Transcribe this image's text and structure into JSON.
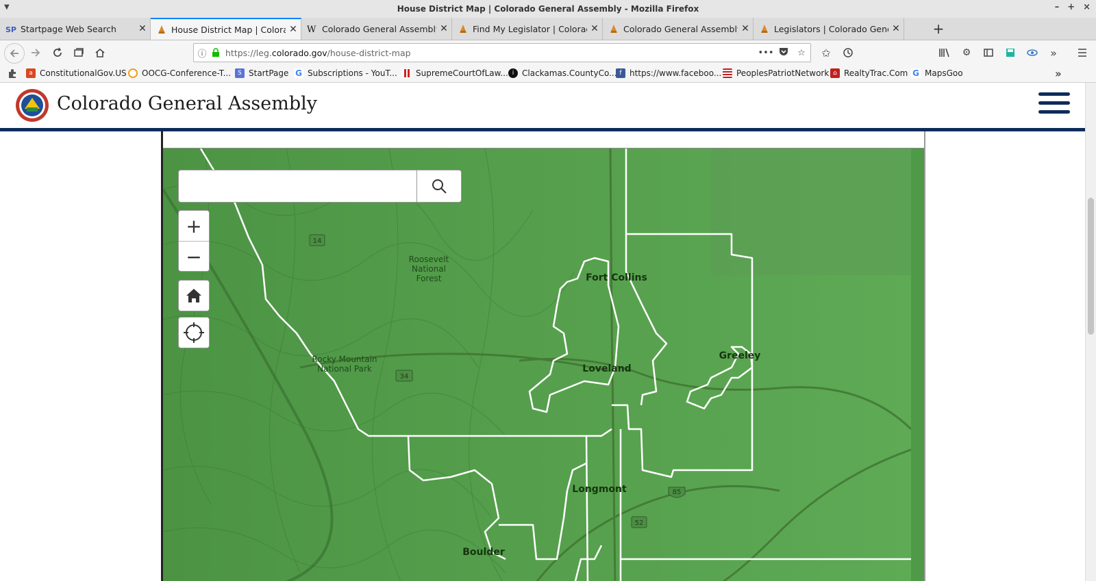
{
  "window": {
    "title": "House District Map | Colorado General Assembly - Mozilla Firefox",
    "controls": [
      "–",
      "+",
      "×"
    ]
  },
  "tabs": [
    {
      "label": "Startpage Web Search",
      "favicon": "startpage-icon"
    },
    {
      "label": "House District Map | Colorad",
      "favicon": "capitol-icon",
      "active": true
    },
    {
      "label": "Colorado General Assembly -",
      "favicon": "wikipedia-icon"
    },
    {
      "label": "Find My Legislator | Colorado",
      "favicon": "capitol-icon"
    },
    {
      "label": "Colorado General Assembly |",
      "favicon": "capitol-icon"
    },
    {
      "label": "Legislators | Colorado Gener",
      "favicon": "capitol-icon"
    }
  ],
  "newtab_label": "+",
  "url": {
    "prefix": "https://leg.",
    "domain": "colorado.gov",
    "path": "/house-district-map"
  },
  "bookmarks": [
    {
      "label": "ConstitutionalGov.US",
      "icon": "ask-icon",
      "color": "#d9481f"
    },
    {
      "label": "OOCG-Conference-T...",
      "icon": "ring-icon",
      "color": "#f0a020"
    },
    {
      "label": "StartPage",
      "icon": "startpage-icon",
      "color": "#5a73d8"
    },
    {
      "label": "Subscriptions - YouT...",
      "icon": "google-icon",
      "color": "#4285f4"
    },
    {
      "label": "SupremeCourtOfLaw...",
      "icon": "bars-icon",
      "color": "#d02020"
    },
    {
      "label": "Clackamas.CountyCo...",
      "icon": "info-icon",
      "color": "#111111"
    },
    {
      "label": "https://www.faceboo...",
      "icon": "facebook-icon",
      "color": "#3b5998"
    },
    {
      "label": "PeoplesPatriotNetwork",
      "icon": "flag-icon",
      "color": "#2a4aa0"
    },
    {
      "label": "RealtyTrac.Com",
      "icon": "house-icon",
      "color": "#c02020"
    },
    {
      "label": "MapsGoo",
      "icon": "google-icon",
      "color": "#4285f4"
    }
  ],
  "bookmarks_overflow": "»",
  "site": {
    "title": "Colorado General Assembly",
    "seal_text": "STATE OF COLORADO",
    "seal_year": "1876"
  },
  "map": {
    "search_placeholder": "",
    "zoom_in": "+",
    "zoom_out": "−",
    "labels": {
      "forest": [
        "Roosevelt",
        "National",
        "Forest"
      ],
      "park": [
        "Rocky Mountain",
        "National Park"
      ],
      "fort_collins": "Fort Collins",
      "loveland": "Loveland",
      "greeley": "Greeley",
      "longmont": "Longmont",
      "boulder": "Boulder"
    },
    "shields": {
      "route14": "14",
      "route34": "34",
      "route85": "85",
      "route52": "52"
    }
  }
}
